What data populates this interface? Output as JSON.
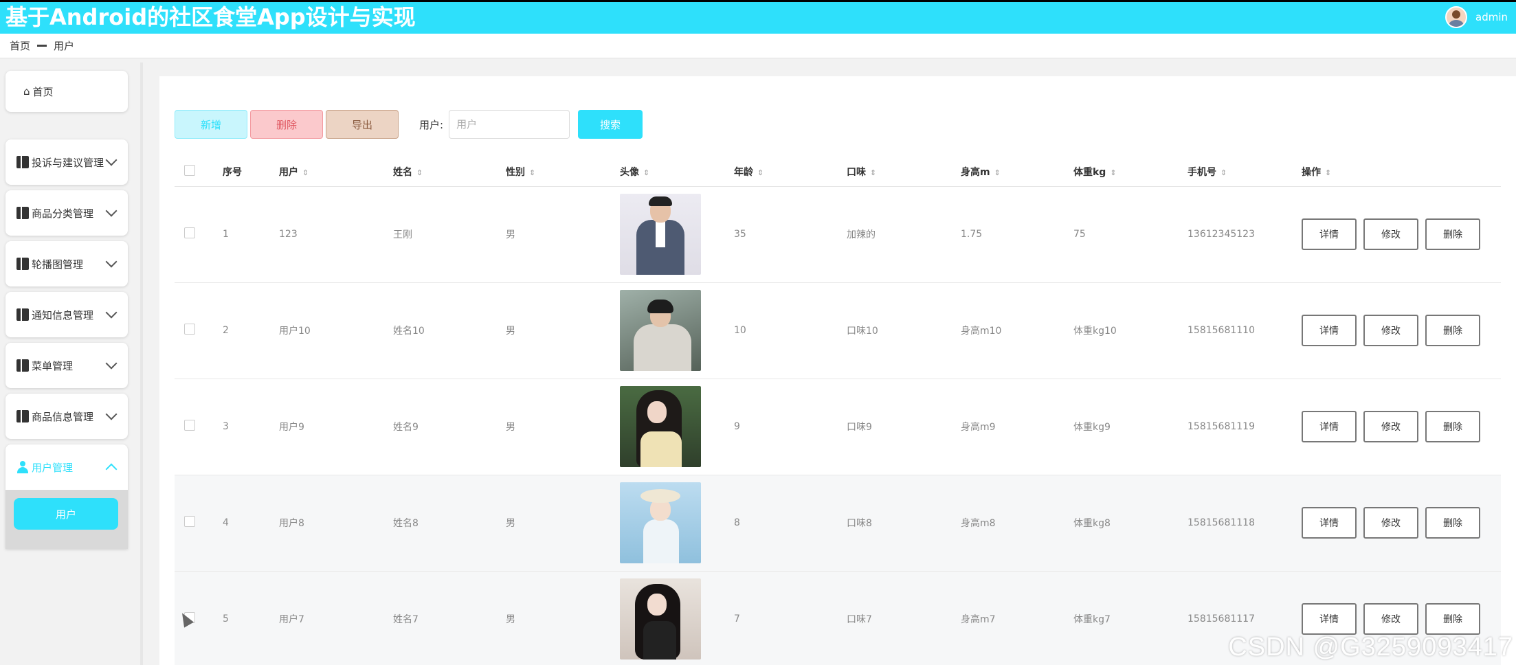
{
  "header": {
    "app_title": "基于Android的社区食堂App设计与实现",
    "user_name": "admin",
    "colors": {
      "accent": "#2ee0fb",
      "bg": "#f2f2f2"
    }
  },
  "breadcrumb": {
    "home": "首页",
    "current": "用户"
  },
  "sidebar": {
    "home_label": "首页",
    "items": [
      {
        "label": "投诉与建议管理",
        "icon": "menu-grid-icon"
      },
      {
        "label": "商品分类管理",
        "icon": "menu-grid-icon"
      },
      {
        "label": "轮播图管理",
        "icon": "menu-grid-icon"
      },
      {
        "label": "通知信息管理",
        "icon": "menu-grid-icon"
      },
      {
        "label": "菜单管理",
        "icon": "menu-grid-icon"
      },
      {
        "label": "商品信息管理",
        "icon": "menu-grid-icon"
      }
    ],
    "active": {
      "label": "用户管理",
      "sub_label": "用户"
    }
  },
  "toolbar": {
    "add_label": "新增",
    "delete_label": "删除",
    "export_label": "导出",
    "search_label": "用户:",
    "search_placeholder": "用户",
    "search_button": "搜索"
  },
  "table": {
    "columns": [
      "序号",
      "用户",
      "姓名",
      "性别",
      "头像",
      "年龄",
      "口味",
      "身高m",
      "体重kg",
      "手机号",
      "操作"
    ],
    "sort_icon": "⇕",
    "rows": [
      {
        "no": "1",
        "user": "123",
        "name": "王刚",
        "gender": "男",
        "age": "35",
        "taste": "加辣的",
        "height": "1.75",
        "weight": "75",
        "phone": "13612345123"
      },
      {
        "no": "2",
        "user": "用户10",
        "name": "姓名10",
        "gender": "男",
        "age": "10",
        "taste": "口味10",
        "height": "身高m10",
        "weight": "体重kg10",
        "phone": "15815681110"
      },
      {
        "no": "3",
        "user": "用户9",
        "name": "姓名9",
        "gender": "男",
        "age": "9",
        "taste": "口味9",
        "height": "身高m9",
        "weight": "体重kg9",
        "phone": "15815681119"
      },
      {
        "no": "4",
        "user": "用户8",
        "name": "姓名8",
        "gender": "男",
        "age": "8",
        "taste": "口味8",
        "height": "身高m8",
        "weight": "体重kg8",
        "phone": "15815681118"
      },
      {
        "no": "5",
        "user": "用户7",
        "name": "姓名7",
        "gender": "男",
        "age": "7",
        "taste": "口味7",
        "height": "身高m7",
        "weight": "体重kg7",
        "phone": "15815681117"
      }
    ],
    "actions": {
      "detail": "详情",
      "edit": "修改",
      "delete": "删除"
    }
  },
  "watermark": "CSDN @G3259093417"
}
